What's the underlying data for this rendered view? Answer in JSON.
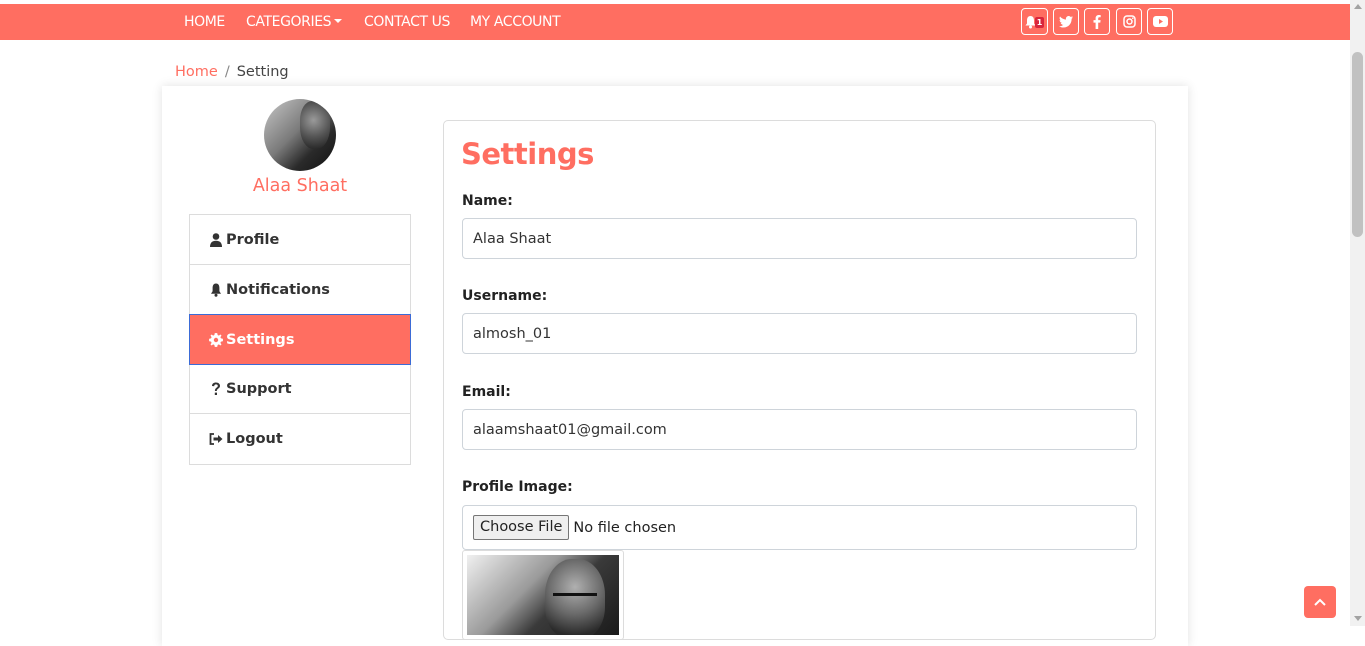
{
  "navbar": {
    "links": [
      "HOME",
      "CATEGORIES",
      "CONTACT US",
      "MY ACCOUNT"
    ],
    "notification_count": "1",
    "social_icons": [
      "bell-icon",
      "twitter-icon",
      "facebook-icon",
      "instagram-icon",
      "youtube-icon"
    ],
    "bg_color": "#ff6e61"
  },
  "breadcrumb": {
    "home": "Home",
    "separator": "/",
    "current": "Setting"
  },
  "user": {
    "name": "Alaa Shaat"
  },
  "menu": {
    "items": [
      {
        "label": "Profile",
        "icon": "user-icon"
      },
      {
        "label": "Notifications",
        "icon": "bell-icon"
      },
      {
        "label": "Settings",
        "icon": "gear-icon",
        "active": true
      },
      {
        "label": "Support",
        "icon": "question-icon"
      },
      {
        "label": "Logout",
        "icon": "logout-icon"
      }
    ]
  },
  "settings": {
    "title": "Settings",
    "name_label": "Name:",
    "name_value": "Alaa Shaat",
    "username_label": "Username:",
    "username_value": "almosh_01",
    "email_label": "Email:",
    "email_value": "alaamshaat01@gmail.com",
    "image_label": "Profile Image:",
    "file_button": "Choose File",
    "file_status": "No file chosen"
  },
  "accent_color": "#ff6e61"
}
